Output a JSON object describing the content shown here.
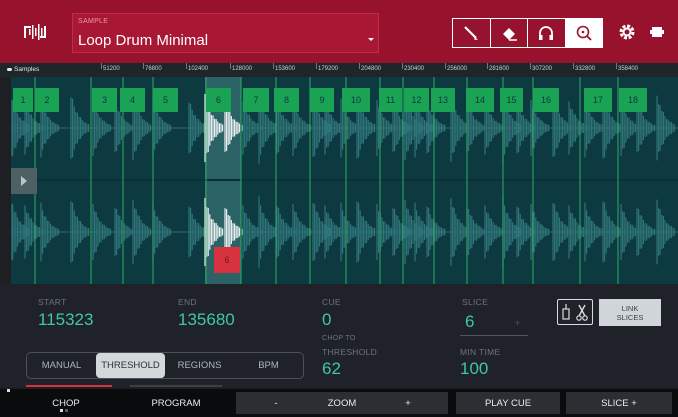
{
  "header": {
    "sample_caption": "SAMPLE",
    "sample_name": "Loop Drum Minimal",
    "tools": [
      "pencil-icon",
      "eraser-icon",
      "headphones-icon",
      "zoom-icon"
    ],
    "active_tool": "zoom-icon",
    "colors": {
      "bar": "#96122d",
      "field": "#a81733"
    }
  },
  "ruler": {
    "label": "Samples",
    "ticks": [
      "51200",
      "76800",
      "102400",
      "128000",
      "153600",
      "179200",
      "204800",
      "230400",
      "256000",
      "281600",
      "307200",
      "332800",
      "358400"
    ]
  },
  "waveform": {
    "slices": [
      "1",
      "2",
      "3",
      "4",
      "5",
      "6",
      "7",
      "8",
      "9",
      "10",
      "11",
      "12",
      "13",
      "14",
      "15",
      "16",
      "17",
      "18"
    ],
    "selected_slice": "6",
    "colors": {
      "background": "#0d3a40",
      "slice_tag": "#1aa354",
      "selected_marker": "#d63240"
    }
  },
  "params": {
    "start": {
      "label": "START",
      "value": "115323"
    },
    "end": {
      "label": "END",
      "value": "135680"
    },
    "cue": {
      "label": "CUE",
      "value": "0"
    },
    "slice": {
      "label": "SLICE",
      "value": "6",
      "plus": "+"
    },
    "chop_to": "CHOP TO",
    "threshold": {
      "label": "THRESHOLD",
      "value": "62"
    },
    "min_time": {
      "label": "MIN TIME",
      "value": "100"
    },
    "link_slices_line1": "LINK",
    "link_slices_line2": "SLICES"
  },
  "modes": {
    "items": [
      "MANUAL",
      "THRESHOLD",
      "REGIONS",
      "BPM"
    ],
    "active": "THRESHOLD"
  },
  "bottom": {
    "chop": "CHOP",
    "program": "PROGRAM",
    "zoom_minus": "-",
    "zoom": "ZOOM",
    "zoom_plus": "+",
    "play_cue": "PLAY CUE",
    "slice_plus": "SLICE +"
  }
}
